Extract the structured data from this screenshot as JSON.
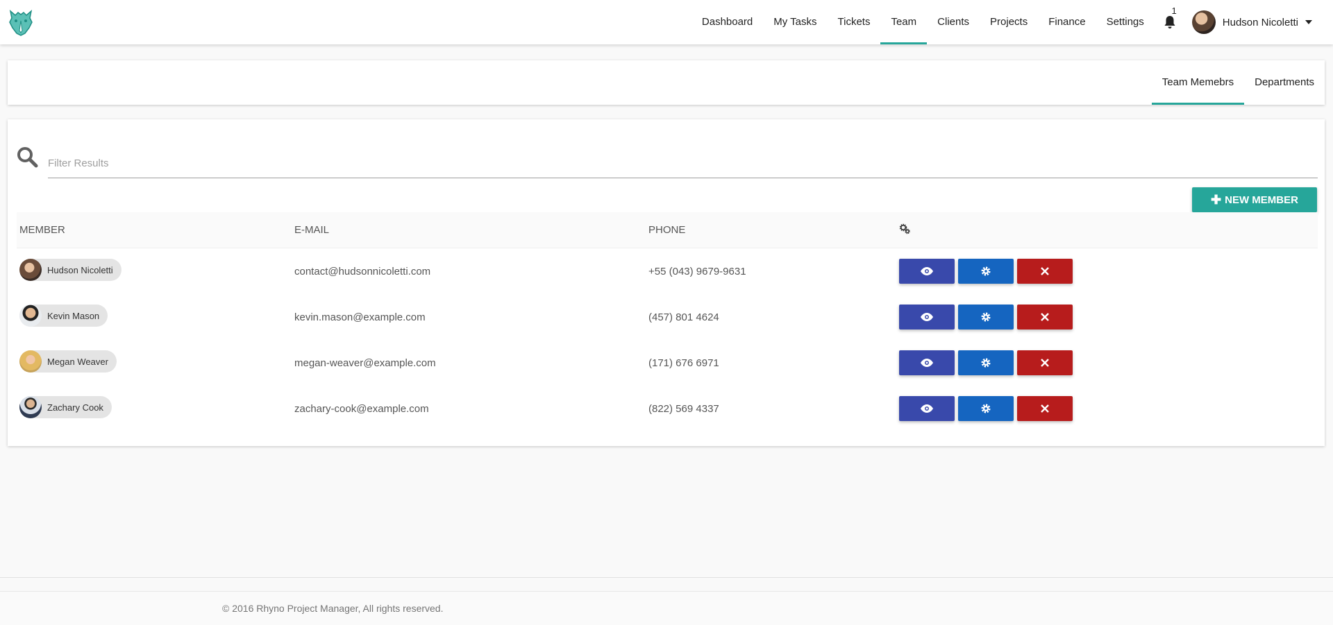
{
  "colors": {
    "accent": "#26a69a",
    "view_button": "#3949ab",
    "edit_button": "#1565c0",
    "delete_button": "#b71c1c"
  },
  "header": {
    "logo_icon": "rhino-logo-icon",
    "nav": [
      {
        "label": "Dashboard"
      },
      {
        "label": "My Tasks"
      },
      {
        "label": "Tickets"
      },
      {
        "label": "Team"
      },
      {
        "label": "Clients"
      },
      {
        "label": "Projects"
      },
      {
        "label": "Finance"
      },
      {
        "label": "Settings"
      }
    ],
    "active_nav": "Team",
    "notifications_count": "1",
    "user_name": "Hudson Nicoletti"
  },
  "tabs": [
    {
      "label": "Team Memebrs"
    },
    {
      "label": "Departments"
    }
  ],
  "active_tab": "Team Memebrs",
  "search": {
    "placeholder": "Filter Results",
    "value": ""
  },
  "new_member_label": "NEW MEMBER",
  "table": {
    "headers": {
      "member": "MEMBER",
      "email": "E-MAIL",
      "phone": "PHONE",
      "actions_icon": "gears-icon"
    },
    "rows": [
      {
        "name": "Hudson Nicoletti",
        "email": "contact@hudsonnicoletti.com",
        "phone": "+55 (043) 9679-9631"
      },
      {
        "name": "Kevin Mason",
        "email": "kevin.mason@example.com",
        "phone": "(457) 801 4624"
      },
      {
        "name": "Megan Weaver",
        "email": "megan-weaver@example.com",
        "phone": "(171) 676 6971"
      },
      {
        "name": "Zachary Cook",
        "email": "zachary-cook@example.com",
        "phone": "(822) 569 4337"
      }
    ]
  },
  "footer": {
    "copyright": "© 2016 Rhyno Project Manager, All rights reserved."
  }
}
